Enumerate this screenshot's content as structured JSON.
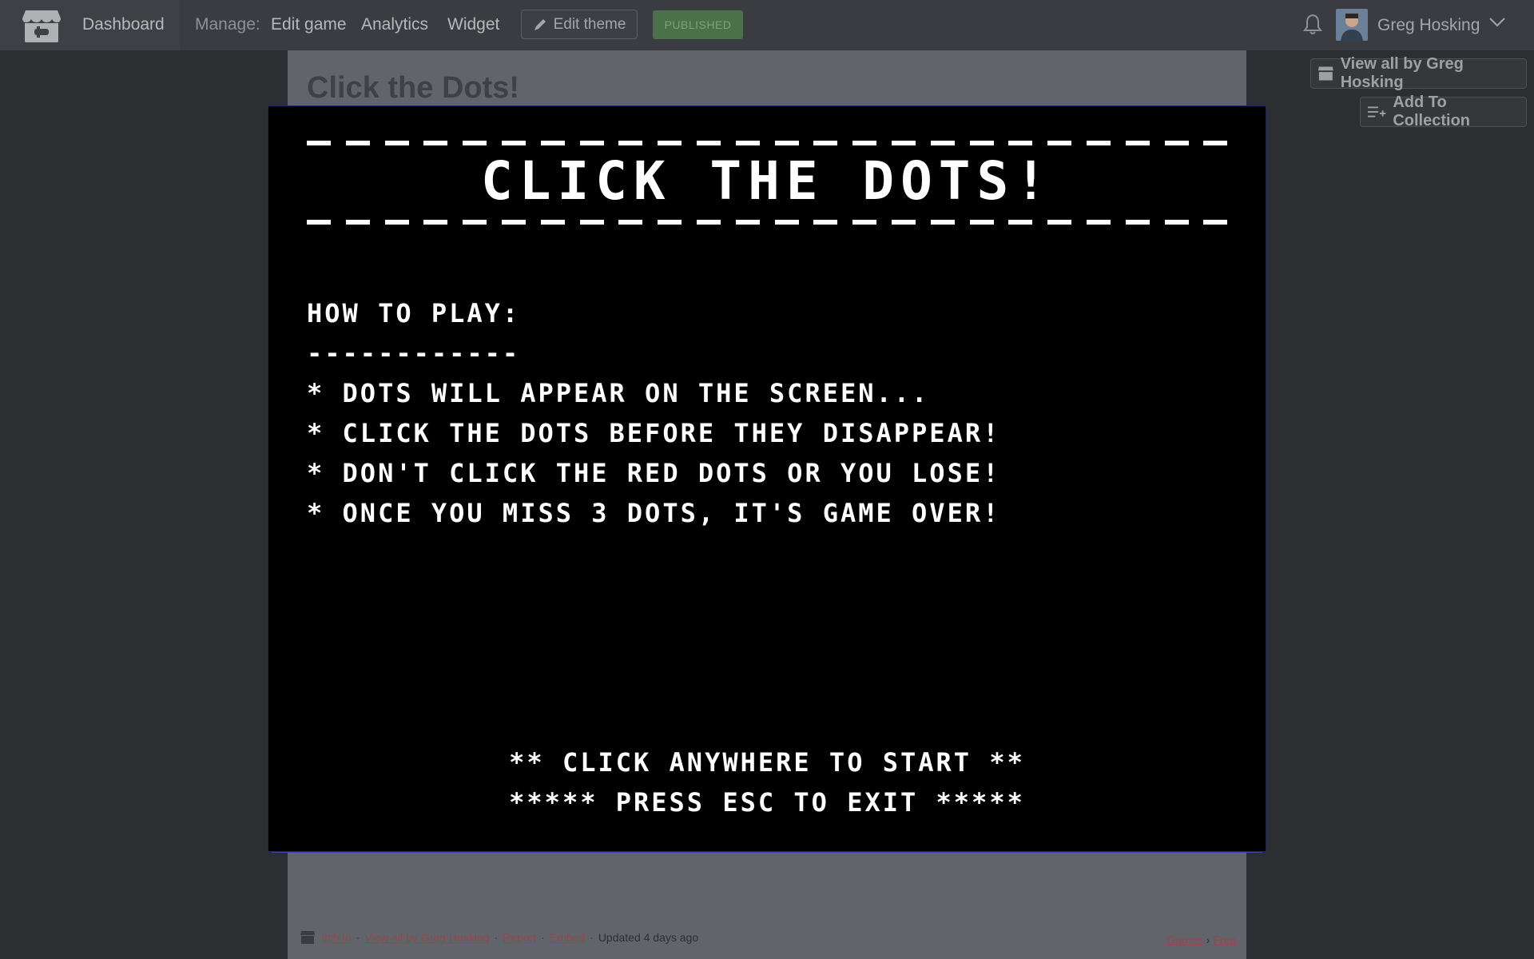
{
  "topbar": {
    "dashboard_label": "Dashboard",
    "manage_label": "Manage:",
    "nav": [
      "Edit game",
      "Analytics",
      "Widget"
    ],
    "edit_theme_label": "Edit theme",
    "published_label": "PUBLISHED",
    "user_name": "Greg Hosking"
  },
  "page": {
    "title": "Click the Dots!",
    "view_all_label": "View all by Greg Hosking",
    "add_collection_label": "Add To Collection"
  },
  "footer": {
    "site": "itch.io",
    "view_all": "View all by Greg Hosking",
    "report": "Report",
    "embed": "Embed",
    "updated": "Updated 4 days ago",
    "crumb_games": "Games",
    "crumb_free": "Free"
  },
  "game": {
    "title": "CLICK THE DOTS!",
    "how_to_play": "HOW TO PLAY:",
    "how_to_play_underline": "------------",
    "rules": [
      "* DOTS WILL APPEAR ON THE SCREEN...",
      "* CLICK THE DOTS BEFORE THEY DISAPPEAR!",
      "* DON'T CLICK THE RED DOTS OR YOU LOSE!",
      "* ONCE YOU MISS 3 DOTS, IT'S GAME OVER!"
    ],
    "start_prompt": "** CLICK ANYWHERE TO START **",
    "exit_prompt": "***** PRESS ESC TO EXIT *****"
  },
  "colors": {
    "topbar": "#3a3c41",
    "published_bg": "#4a7148",
    "game_bg": "#000000",
    "game_text": "#ffffff"
  }
}
